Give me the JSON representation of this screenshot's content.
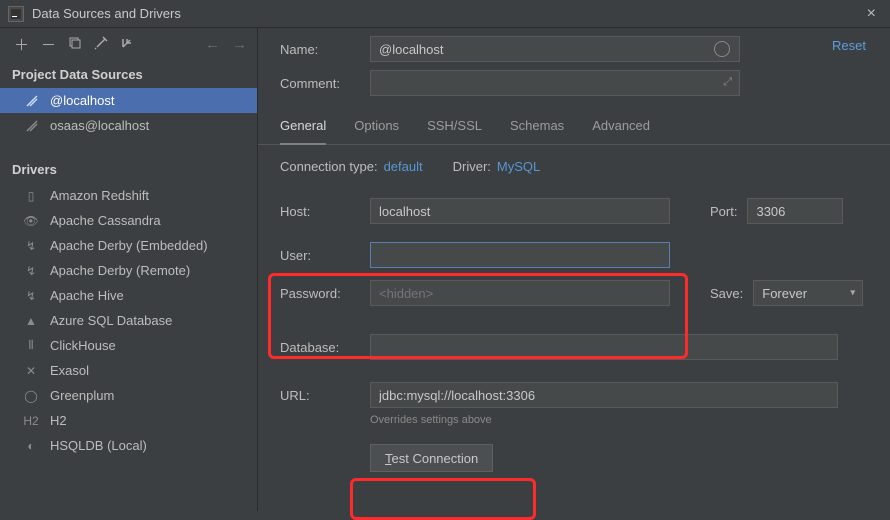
{
  "window": {
    "title": "Data Sources and Drivers"
  },
  "sidebar": {
    "toolbar": {},
    "dataSourcesHeader": "Project Data Sources",
    "dataSources": [
      {
        "label": "@localhost"
      },
      {
        "label": "osaas@localhost"
      }
    ],
    "driversHeader": "Drivers",
    "drivers": [
      {
        "label": "Amazon Redshift",
        "icon": "▯"
      },
      {
        "label": "Apache Cassandra",
        "icon": "👁"
      },
      {
        "label": "Apache Derby (Embedded)",
        "icon": "↯"
      },
      {
        "label": "Apache Derby (Remote)",
        "icon": "↯"
      },
      {
        "label": "Apache Hive",
        "icon": "↯"
      },
      {
        "label": "Azure SQL Database",
        "icon": "▲"
      },
      {
        "label": "ClickHouse",
        "icon": "⦀"
      },
      {
        "label": "Exasol",
        "icon": "✕"
      },
      {
        "label": "Greenplum",
        "icon": "◯"
      },
      {
        "label": "H2",
        "icon": "H2"
      },
      {
        "label": "HSQLDB (Local)",
        "icon": "◐"
      }
    ]
  },
  "form": {
    "nameLabel": "Name:",
    "nameValue": "@localhost",
    "resetLabel": "Reset",
    "commentLabel": "Comment:",
    "commentValue": "",
    "tabs": [
      "General",
      "Options",
      "SSH/SSL",
      "Schemas",
      "Advanced"
    ],
    "connTypeLabel": "Connection type:",
    "connTypeValue": "default",
    "driverLabel": "Driver:",
    "driverValue": "MySQL",
    "hostLabel": "Host:",
    "hostValue": "localhost",
    "portLabel": "Port:",
    "portValue": "3306",
    "userLabel": "User:",
    "userValue": "",
    "passwordLabel": "Password:",
    "passwordPlaceholder": "<hidden>",
    "saveLabel": "Save:",
    "saveValue": "Forever",
    "databaseLabel": "Database:",
    "databaseValue": "",
    "urlLabel": "URL:",
    "urlValue": "jdbc:mysql://localhost:3306",
    "urlHint": "Overrides settings above",
    "testBtn": "Test Connection"
  }
}
